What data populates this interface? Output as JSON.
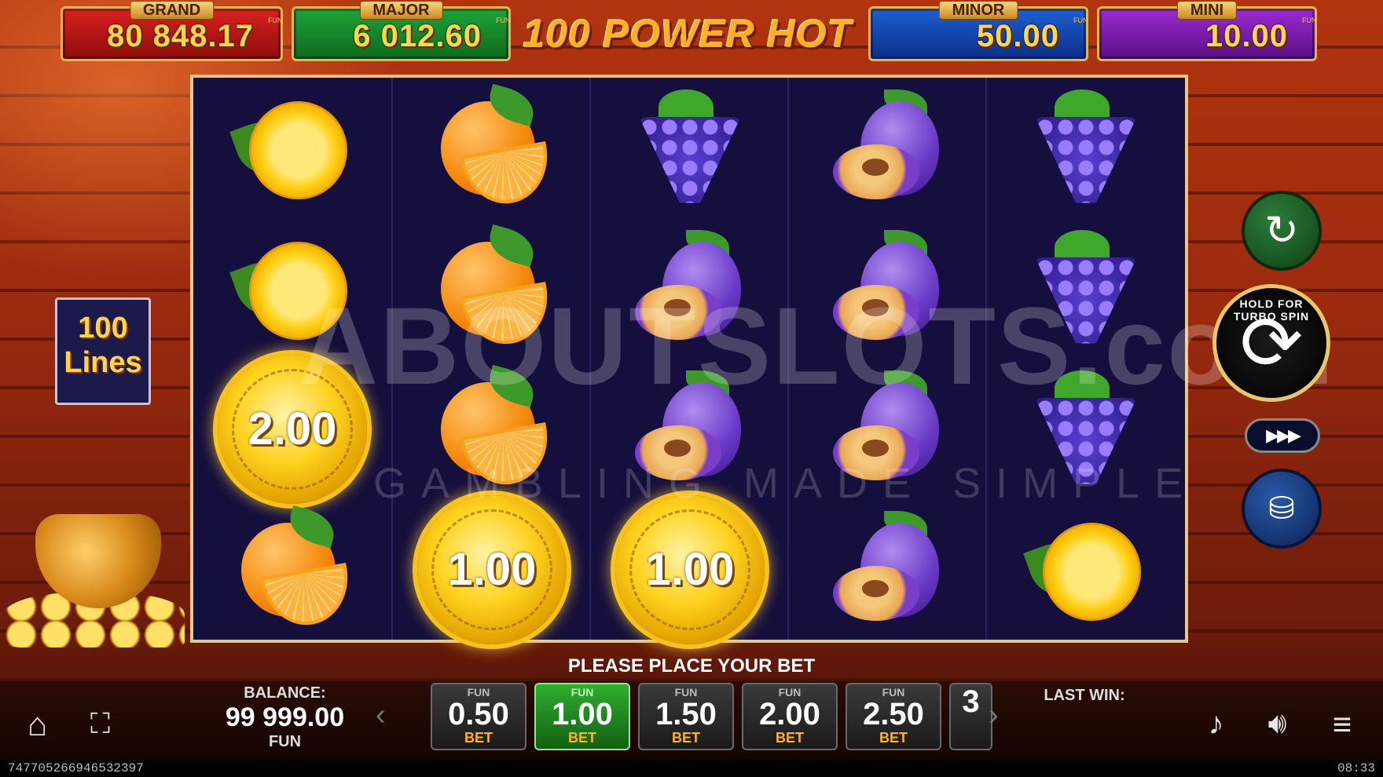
{
  "title": "100 POWER HOT",
  "jackpots": {
    "grand": {
      "label": "GRAND",
      "value": "80 848.17",
      "fun": "FUN"
    },
    "major": {
      "label": "MAJOR",
      "value": "6 012.60",
      "fun": "FUN"
    },
    "minor": {
      "label": "MINOR",
      "value": "50.00",
      "fun": "FUN"
    },
    "mini": {
      "label": "MINI",
      "value": "10.00",
      "fun": "FUN"
    }
  },
  "lines_badge": {
    "number": "100",
    "label": "Lines"
  },
  "reels": [
    [
      "lemon",
      "lemon",
      "coin",
      "orange"
    ],
    [
      "orange",
      "orange",
      "orange",
      "coin"
    ],
    [
      "grapes",
      "plum",
      "plum",
      "coin"
    ],
    [
      "plum",
      "plum",
      "plum",
      "plum"
    ],
    [
      "grapes",
      "grapes",
      "grapes",
      "lemon"
    ]
  ],
  "coin_values": {
    "c0r2": "2.00",
    "c1r3": "1.00",
    "c2r3": "1.00"
  },
  "controls": {
    "spin_text": "HOLD FOR TURBO SPIN",
    "autoplay_icon": "autoplay-icon",
    "turbo_icon": "fast-forward-icon",
    "coins_icon": "coins-stack-icon"
  },
  "prompt": "PLEASE PLACE YOUR BET",
  "balance": {
    "label": "BALANCE:",
    "value": "99 999.00",
    "currency": "FUN"
  },
  "bets": [
    {
      "fun": "FUN",
      "amount": "0.50",
      "label": "BET",
      "active": false
    },
    {
      "fun": "FUN",
      "amount": "1.00",
      "label": "BET",
      "active": true
    },
    {
      "fun": "FUN",
      "amount": "1.50",
      "label": "BET",
      "active": false
    },
    {
      "fun": "FUN",
      "amount": "2.00",
      "label": "BET",
      "active": false
    },
    {
      "fun": "FUN",
      "amount": "2.50",
      "label": "BET",
      "active": false
    },
    {
      "fun": "",
      "amount": "3",
      "label": "",
      "active": false
    }
  ],
  "last_win_label": "LAST WIN:",
  "status": {
    "session_id": "747705266946532397",
    "time": "08:33"
  },
  "watermark": {
    "main": "ABOUTSLOTS.com",
    "sub": "GAMBLING MADE SIMPLE"
  }
}
